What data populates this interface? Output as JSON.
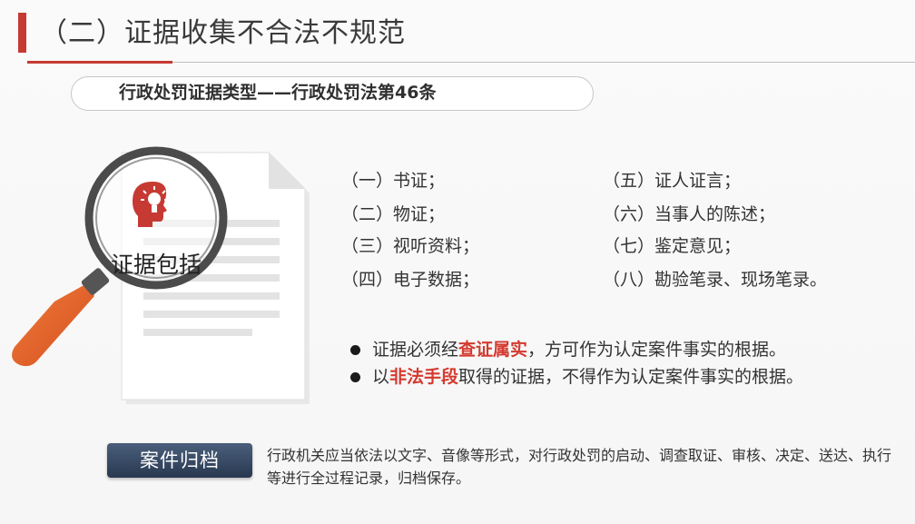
{
  "header": {
    "title": "（二）证据收集不合法不规范"
  },
  "subtitle_pill": {
    "text": "行政处罚证据类型——行政处罚法第46条"
  },
  "illustration": {
    "label": "证据包括",
    "accent_color": "#c63a33",
    "handle_color": "#e8622a"
  },
  "evidence_types": {
    "left": [
      "（一）书证；",
      "（二）物证；",
      "（三）视听资料；",
      "（四）电子数据；"
    ],
    "right": [
      "（五）证人证言；",
      "（六）当事人的陈述；",
      "（七）鉴定意见；",
      "（八）勘验笔录、现场笔录。"
    ]
  },
  "bullets": [
    {
      "prefix": "证据必须经",
      "highlight": "查证属实",
      "suffix": "，方可作为认定案件事实的根据。"
    },
    {
      "prefix": "以",
      "highlight": "非法手段",
      "suffix": "取得的证据，不得作为认定案件事实的根据。"
    }
  ],
  "archive": {
    "button_label": "案件归档",
    "description": "行政机关应当依法以文字、音像等形式，对行政处罚的启动、调查取证、审核、决定、送达、执行等进行全过程记录，归档保存。"
  },
  "colors": {
    "accent": "#c63a33",
    "highlight_text": "#d43a2f",
    "button": "#2f3f56"
  }
}
